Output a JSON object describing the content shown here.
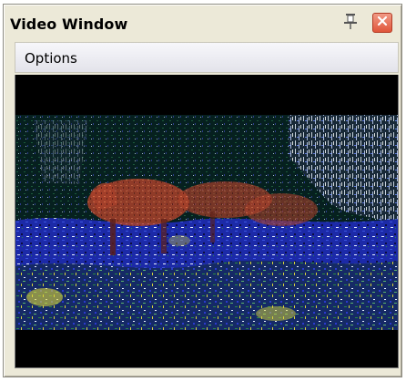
{
  "window": {
    "title": "Video Window",
    "pin_icon": "pin-icon",
    "close_icon": "close-icon"
  },
  "menu": {
    "items": [
      {
        "label": "Options"
      }
    ]
  },
  "video": {
    "content": "video-frame",
    "scene_colors": {
      "background": "#000000",
      "foliage_dark": "#0b2a2a",
      "foliage_blue": "#2233cc",
      "foliage_white": "#e8f0ff",
      "deer_brown": "#b0442c",
      "grass_green": "#2a8a44",
      "highlight_yellow": "#d8d43a"
    }
  },
  "colors": {
    "close_button": "#e0553a",
    "window_bg": "#ece9d8",
    "menu_bg": "#ececf2"
  }
}
